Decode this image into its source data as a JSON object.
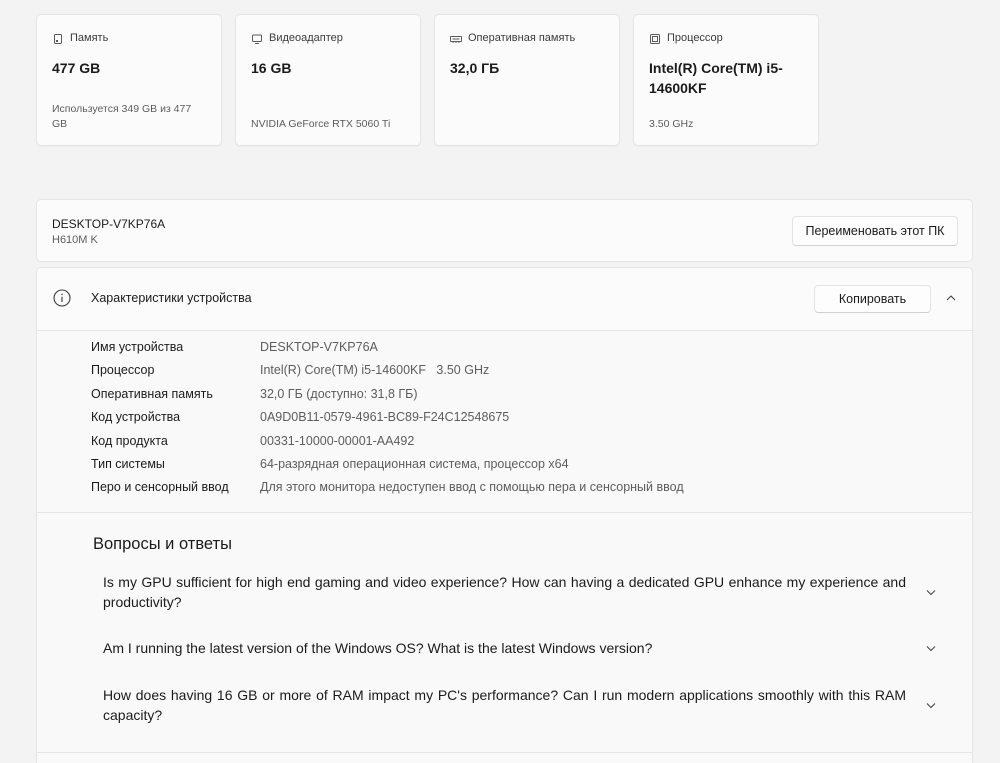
{
  "colors": {
    "background": "#f3f3f3",
    "card": "#fbfbfb",
    "card_alt": "#f9f9f9",
    "border": "#e5e5e5",
    "text_primary": "#1b1b1b",
    "text_secondary": "#5d5d5d"
  },
  "summary_cards": [
    {
      "icon": "storage-icon",
      "label": "Память",
      "value": "477 GB",
      "sub": "Используется 349 GB из 477 GB"
    },
    {
      "icon": "gpu-icon",
      "label": "Видеоадаптер",
      "value": "16 GB",
      "sub": "NVIDIA GeForce RTX 5060 Ti"
    },
    {
      "icon": "ram-icon",
      "label": "Оперативная память",
      "value": "32,0 ГБ"
    },
    {
      "icon": "cpu-icon",
      "label": "Процессор",
      "value": "Intel(R) Core(TM) i5-14600KF",
      "sub": "3.50 GHz"
    }
  ],
  "device": {
    "name": "DESKTOP-V7KP76A",
    "model": "H610M K",
    "rename_label": "Переименовать этот ПК"
  },
  "specs": {
    "icon": "info-icon",
    "title": "Характеристики устройства",
    "copy_label": "Копировать",
    "rows": [
      {
        "label": "Имя устройства",
        "value": "DESKTOP-V7KP76A"
      },
      {
        "label": "Процессор",
        "value": "Intel(R) Core(TM) i5-14600KF   3.50 GHz"
      },
      {
        "label": "Оперативная память",
        "value": "32,0 ГБ (доступно: 31,8 ГБ)"
      },
      {
        "label": "Код устройства",
        "value": "0A9D0B11-0579-4961-BC89-F24C12548675"
      },
      {
        "label": "Код продукта",
        "value": "00331-10000-00001-AA492"
      },
      {
        "label": "Тип системы",
        "value": "64-разрядная операционная система, процессор x64"
      },
      {
        "label": "Перо и сенсорный ввод",
        "value": "Для этого монитора недоступен ввод с помощью пера и сенсорный ввод"
      }
    ]
  },
  "faq": {
    "title": "Вопросы и ответы",
    "items": [
      "Is my GPU sufficient for high end gaming and video experience? How can having a dedicated GPU enhance my experience and productivity?",
      "Am I running the latest version of the Windows OS? What is the latest Windows version?",
      "How does having 16 GB or more of RAM impact my PC's performance? Can I run modern applications smoothly with this RAM capacity?"
    ]
  }
}
